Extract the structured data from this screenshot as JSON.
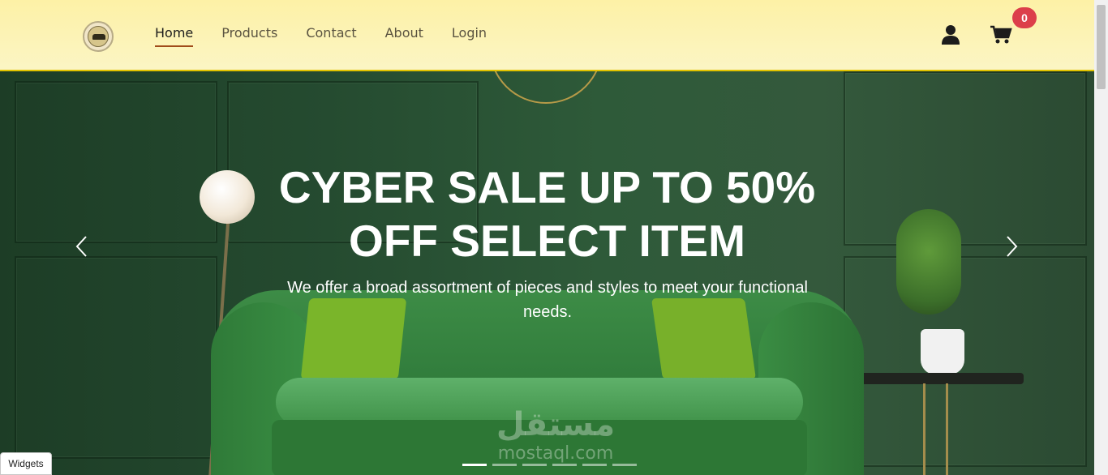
{
  "brand": {
    "logo_icon": "sofa-logo-icon"
  },
  "nav": {
    "links": [
      {
        "label": "Home",
        "active": true
      },
      {
        "label": "Products",
        "active": false
      },
      {
        "label": "Contact",
        "active": false
      },
      {
        "label": "About",
        "active": false
      },
      {
        "label": "Login",
        "active": false
      }
    ]
  },
  "header_icons": {
    "user_icon": "user-icon",
    "cart_icon": "cart-icon"
  },
  "cart": {
    "count": "0"
  },
  "hero": {
    "title_line1": "CYBER SALE UP TO 50%",
    "title_line2": "OFF SELECT ITEM",
    "subtitle": "We offer a broad assortment of pieces and styles to meet your functional needs.",
    "prev_icon": "chevron-left-icon",
    "next_icon": "chevron-right-icon",
    "slide_count": 6,
    "active_slide": 1
  },
  "watermark": {
    "arabic": "مستقل",
    "latin": "mostaql.com"
  },
  "widgets_button": {
    "label": "Widgets"
  },
  "colors": {
    "header_bg": "#fdf1a6",
    "header_border": "#e2c300",
    "active_underline": "#a04b1b",
    "badge": "#dc3f4a"
  }
}
